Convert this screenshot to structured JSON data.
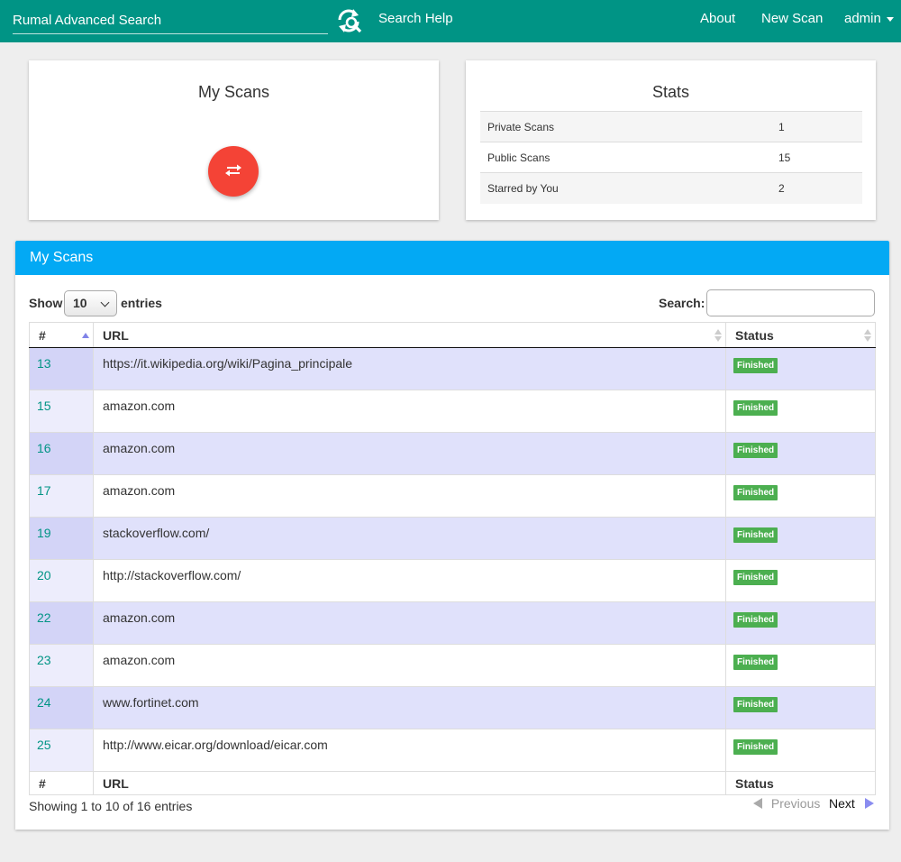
{
  "navbar": {
    "search_placeholder": "Rumal Advanced Search",
    "search_help": "Search Help",
    "links": {
      "about": "About",
      "new_scan": "New Scan",
      "admin": "admin"
    }
  },
  "my_scans_card": {
    "title": "My Scans"
  },
  "stats": {
    "title": "Stats",
    "rows": [
      {
        "label": "Private Scans",
        "value": "1"
      },
      {
        "label": "Public Scans",
        "value": "15"
      },
      {
        "label": "Starred by You",
        "value": "2"
      }
    ]
  },
  "scans_panel": {
    "title": "My Scans",
    "length": {
      "show": "Show",
      "selected": "10",
      "entries": "entries"
    },
    "search_label": "Search:",
    "columns": [
      "#",
      "URL",
      "Status"
    ],
    "rows": [
      {
        "id": "13",
        "url": "https://it.wikipedia.org/wiki/Pagina_principale",
        "status": "Finished"
      },
      {
        "id": "15",
        "url": "amazon.com",
        "status": "Finished"
      },
      {
        "id": "16",
        "url": "amazon.com",
        "status": "Finished"
      },
      {
        "id": "17",
        "url": "amazon.com",
        "status": "Finished"
      },
      {
        "id": "19",
        "url": "stackoverflow.com/",
        "status": "Finished"
      },
      {
        "id": "20",
        "url": "http://stackoverflow.com/",
        "status": "Finished"
      },
      {
        "id": "22",
        "url": "amazon.com",
        "status": "Finished"
      },
      {
        "id": "23",
        "url": "amazon.com",
        "status": "Finished"
      },
      {
        "id": "24",
        "url": "www.fortinet.com",
        "status": "Finished"
      },
      {
        "id": "25",
        "url": "http://www.eicar.org/download/eicar.com",
        "status": "Finished"
      }
    ],
    "info": "Showing 1 to 10 of 16 entries",
    "pagination": {
      "previous": "Previous",
      "next": "Next"
    }
  },
  "colors": {
    "navbar": "#009485",
    "panel_header": "#03a9f4",
    "fab": "#f44336",
    "badge": "#4caf50",
    "link": "#009485"
  },
  "icons": {
    "refresh": "refresh-search-icon",
    "fab": "swap-arrows-icon",
    "admin_caret": "caret-down-icon",
    "sort": "sort-icon",
    "prev": "arrow-left-icon",
    "next": "arrow-right-icon"
  }
}
